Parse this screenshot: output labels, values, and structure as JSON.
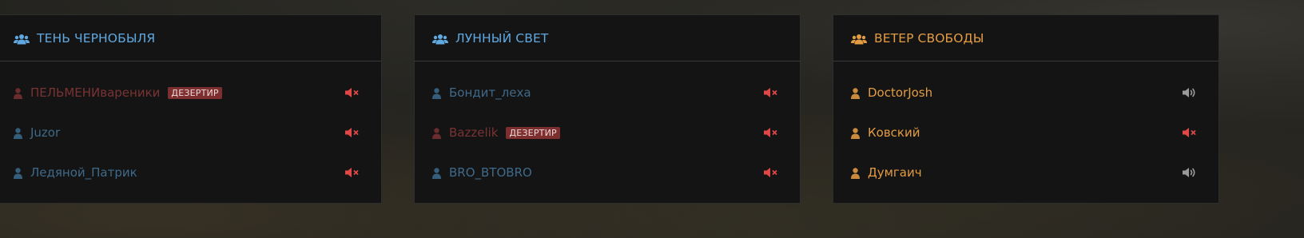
{
  "panels": [
    {
      "team": "ТЕНЬ ЧЕРНОБЫЛЯ",
      "team_color": "#5fa8e0",
      "team_icon": "users-icon",
      "players": [
        {
          "name": "ПЕЛЬМЕНИвареники",
          "status": "deserter",
          "badge": "ДЕЗЕРТИР",
          "voice": "muted"
        },
        {
          "name": "Juzor",
          "status": "normal",
          "voice": "muted"
        },
        {
          "name": "Ледяной_Патрик",
          "status": "normal",
          "voice": "muted"
        }
      ]
    },
    {
      "team": "ЛУННЫЙ СВЕТ",
      "team_color": "#5fa8e0",
      "team_icon": "users-icon",
      "players": [
        {
          "name": "Бондит_леха",
          "status": "normal",
          "voice": "muted"
        },
        {
          "name": "Bazzelik",
          "status": "deserter",
          "badge": "ДЕЗЕРТИР",
          "voice": "muted"
        },
        {
          "name": "BRO_BTOBRO",
          "status": "normal",
          "voice": "muted"
        }
      ]
    },
    {
      "team": "ВЕТЕР СВОБОДЫ",
      "team_color": "#e39c42",
      "team_icon": "users-icon",
      "players": [
        {
          "name": "DoctorJosh",
          "status": "friendly",
          "voice": "on"
        },
        {
          "name": "Ковский",
          "status": "friendly",
          "voice": "muted"
        },
        {
          "name": "Думгаич",
          "status": "friendly",
          "voice": "on"
        }
      ]
    }
  ],
  "colors": {
    "normal_name": "#3f6a8a",
    "normal_icon": "#355e7c",
    "deserter_name": "#7a3333",
    "deserter_icon": "#6a2c2c",
    "friendly_name": "#e39c42",
    "friendly_icon": "#c98a3d",
    "muted_icon": "#e04848",
    "voice_on_icon": "#9a9a9a"
  }
}
